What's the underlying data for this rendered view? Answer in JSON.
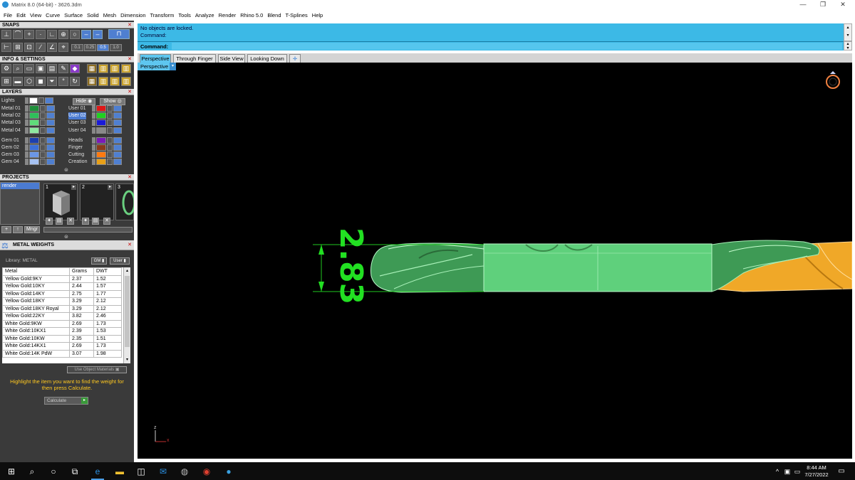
{
  "window": {
    "title": "Matrix 8.0 (64-bit) - 3626.3dm",
    "minimize": "—",
    "maximize": "❐",
    "close": "✕"
  },
  "menu": [
    "File",
    "Edit",
    "View",
    "Curve",
    "Surface",
    "Solid",
    "Mesh",
    "Dimension",
    "Transform",
    "Tools",
    "Analyze",
    "Render",
    "Rhino 5.0",
    "Blend",
    "T-Splines",
    "Help"
  ],
  "panels": {
    "snaps": {
      "title": "SNAPS",
      "values": [
        "0.1",
        "0.25",
        "0.5",
        "1.0"
      ]
    },
    "info": {
      "title": "INFO & SETTINGS"
    },
    "layers": {
      "title": "LAYERS",
      "hide_label": "Hide",
      "show_label": "Show",
      "lights": "Lights",
      "left_column": [
        {
          "name": "Metal 01",
          "color": "#1f8f3a"
        },
        {
          "name": "Metal 02",
          "color": "#2fbf5a"
        },
        {
          "name": "Metal 03",
          "color": "#5fdc7a"
        },
        {
          "name": "Metal 04",
          "color": "#8fe8a0"
        },
        {
          "name": "Gem 01",
          "color": "#1c3fae"
        },
        {
          "name": "Gem 02",
          "color": "#3c6fd8"
        },
        {
          "name": "Gem 03",
          "color": "#6b96e6"
        },
        {
          "name": "Gem 04",
          "color": "#a6c2f2"
        }
      ],
      "right_column": [
        {
          "name": "User 01",
          "color": "#e01818"
        },
        {
          "name": "User 02",
          "color": "#20d020"
        },
        {
          "name": "User 03",
          "color": "#1a1ad8"
        },
        {
          "name": "User 04",
          "color": "#8a8a8a"
        },
        {
          "name": "Heads",
          "color": "#7a1ab8"
        },
        {
          "name": "Finger",
          "color": "#8a3a1a"
        },
        {
          "name": "Cutting",
          "color": "#ff7a10"
        },
        {
          "name": "Creation",
          "color": "#e8a018"
        }
      ]
    },
    "projects": {
      "title": "PROJECTS",
      "list": [
        "render"
      ],
      "thumbnails": [
        "1",
        "2",
        "3"
      ],
      "mngr_label": "Mngr"
    },
    "metal_weights": {
      "title": "METAL WEIGHTS",
      "library_label": "Library: METAL",
      "gm_label": "GM",
      "user_label": "User",
      "columns": [
        "Metal",
        "Grams",
        "DWT"
      ],
      "rows": [
        [
          "Yellow Gold:9KY",
          "2.37",
          "1.52"
        ],
        [
          "Yellow Gold:10KY",
          "2.44",
          "1.57"
        ],
        [
          "Yellow Gold:14KY",
          "2.75",
          "1.77"
        ],
        [
          "Yellow Gold:18KY",
          "3.29",
          "2.12"
        ],
        [
          "Yellow Gold:18KY Royal",
          "3.29",
          "2.12"
        ],
        [
          "Yellow Gold:22KY",
          "3.82",
          "2.46"
        ],
        [
          "White Gold:9KW",
          "2.69",
          "1.73"
        ],
        [
          "White Gold:10KX1",
          "2.39",
          "1.53"
        ],
        [
          "White Gold:10KW",
          "2.35",
          "1.51"
        ],
        [
          "White Gold:14KX1",
          "2.69",
          "1.73"
        ],
        [
          "White Gold:14K PdW",
          "3.07",
          "1.98"
        ]
      ],
      "use_object_materials": "Use Object Materials",
      "hint": "Highlight the item you want to find the weight for then press Calculate.",
      "calculate": "Calculate"
    }
  },
  "command": {
    "history": [
      "No objects are locked.",
      "Command:"
    ],
    "prompt": "Command:",
    "value": ""
  },
  "viewport_tabs": [
    "Perspective",
    "Through Finger",
    "Side View",
    "Looking Down"
  ],
  "add_tab": "✛",
  "active_view": "Perspective",
  "dimension_text": "2.83",
  "axis": {
    "z": "z",
    "x": "x"
  },
  "taskbar": {
    "time": "8:44 AM",
    "date": "7/27/2022"
  },
  "colors": {
    "accent_blue": "#3cb9e6",
    "dimension_green": "#22e022",
    "model_green": "#5fd07c",
    "model_gold": "#f0a828"
  }
}
